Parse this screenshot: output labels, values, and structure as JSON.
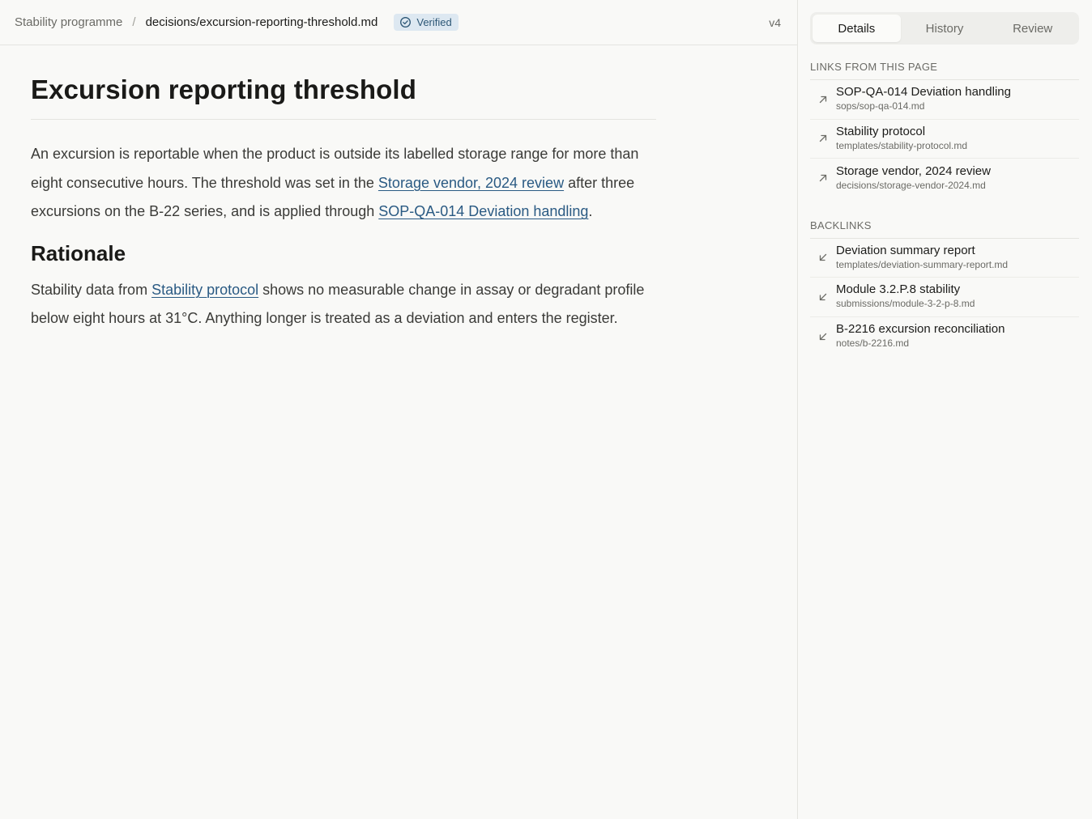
{
  "header": {
    "breadcrumb_root": "Stability programme",
    "breadcrumb_sep": "/",
    "file": "decisions/excursion-reporting-threshold.md",
    "badge": "Verified",
    "version": "v4"
  },
  "doc": {
    "title": "Excursion reporting threshold",
    "p1": {
      "t1": "An excursion is reportable when the product is outside its labelled storage range for more than eight consecutive hours. The threshold was set in the ",
      "link1": "Storage vendor, 2024 review",
      "t2": " after three excursions on the B-22 series, and is applied through ",
      "link2": "SOP-QA-014 Deviation handling",
      "t3": "."
    },
    "h2": "Rationale",
    "p2": {
      "t1": "Stability data from ",
      "link1": "Stability protocol",
      "t2": " shows no measurable change in assay or degradant profile below eight hours at 31°C. Anything longer is treated as a deviation and enters the register."
    }
  },
  "side": {
    "tabs": [
      "Details",
      "History",
      "Review"
    ],
    "active_tab": "Details",
    "links_title": "LINKS FROM THIS PAGE",
    "links": [
      {
        "title": "SOP-QA-014 Deviation handling",
        "path": "sops/sop-qa-014.md"
      },
      {
        "title": "Stability protocol",
        "path": "templates/stability-protocol.md"
      },
      {
        "title": "Storage vendor, 2024 review",
        "path": "decisions/storage-vendor-2024.md"
      }
    ],
    "backlinks_title": "BACKLINKS",
    "backlinks": [
      {
        "title": "Deviation summary report",
        "path": "templates/deviation-summary-report.md"
      },
      {
        "title": "Module 3.2.P.8 stability",
        "path": "submissions/module-3-2-p-8.md"
      },
      {
        "title": "B-2216 excursion reconciliation",
        "path": "notes/b-2216.md"
      }
    ]
  },
  "colors": {
    "link": "#2a5a83",
    "badge_bg": "#dde8f1",
    "badge_text": "#2d5776"
  }
}
